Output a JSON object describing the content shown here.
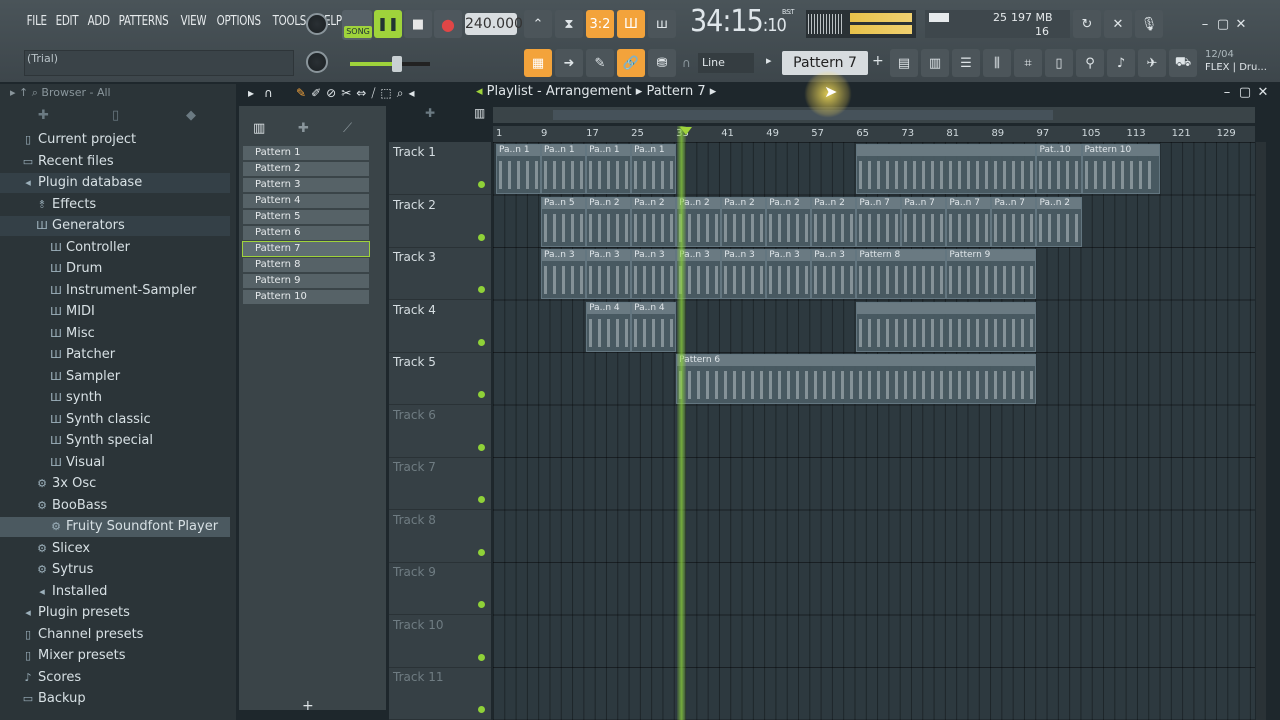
{
  "menu": [
    "FILE",
    "EDIT",
    "ADD",
    "PATTERNS",
    "VIEW",
    "OPTIONS",
    "TOOLS",
    "HELP"
  ],
  "hint_bar": "(Trial)",
  "song_mode": "SONG",
  "tempo": "240.000",
  "time_signature_indicator": "3:2",
  "timecode": {
    "main": "34:15",
    "sub": ":10",
    "label": "B:S:T"
  },
  "cpu": {
    "value": "25",
    "memory": "197 MB",
    "polyphony": "16"
  },
  "pattern_selector": "Pattern 7",
  "snap_mode": "Line",
  "news_panel": {
    "date": "12/04",
    "text": "FLEX | Dru..."
  },
  "browser": {
    "header": "Browser - All",
    "items": [
      {
        "label": "Current project",
        "icon": "doc-icon",
        "indent": 0
      },
      {
        "label": "Recent files",
        "icon": "folder-icon",
        "indent": 0
      },
      {
        "label": "Plugin database",
        "icon": "plug-icon",
        "indent": 0
      },
      {
        "label": "Effects",
        "icon": "effects-icon",
        "indent": 1
      },
      {
        "label": "Generators",
        "icon": "piano-icon",
        "indent": 1
      },
      {
        "label": "Controller",
        "icon": "piano-icon",
        "indent": 2
      },
      {
        "label": "Drum",
        "icon": "piano-icon",
        "indent": 2
      },
      {
        "label": "Instrument-Sampler",
        "icon": "piano-icon",
        "indent": 2
      },
      {
        "label": "MIDI",
        "icon": "piano-icon",
        "indent": 2
      },
      {
        "label": "Misc",
        "icon": "piano-icon",
        "indent": 2
      },
      {
        "label": "Patcher",
        "icon": "piano-icon",
        "indent": 2
      },
      {
        "label": "Sampler",
        "icon": "piano-icon",
        "indent": 2
      },
      {
        "label": "synth",
        "icon": "piano-icon",
        "indent": 2
      },
      {
        "label": "Synth classic",
        "icon": "piano-icon",
        "indent": 2
      },
      {
        "label": "Synth special",
        "icon": "piano-icon",
        "indent": 2
      },
      {
        "label": "Visual",
        "icon": "piano-icon",
        "indent": 2
      },
      {
        "label": "3x Osc",
        "icon": "gear-icon",
        "indent": 1
      },
      {
        "label": "BooBass",
        "icon": "gear-icon",
        "indent": 1
      },
      {
        "label": "Fruity Soundfont Player",
        "icon": "gear-icon",
        "indent": 2
      },
      {
        "label": "Slicex",
        "icon": "gear-icon",
        "indent": 1
      },
      {
        "label": "Sytrus",
        "icon": "gear-icon",
        "indent": 1
      },
      {
        "label": "Installed",
        "icon": "plug-icon",
        "indent": 1
      },
      {
        "label": "Plugin presets",
        "icon": "plug-icon",
        "indent": 0
      },
      {
        "label": "Channel presets",
        "icon": "preset-icon",
        "indent": 0
      },
      {
        "label": "Mixer presets",
        "icon": "preset-icon",
        "indent": 0
      },
      {
        "label": "Scores",
        "icon": "note-icon",
        "indent": 0
      },
      {
        "label": "Backup",
        "icon": "folder-icon",
        "indent": 0
      }
    ]
  },
  "patterns": [
    "Pattern 1",
    "Pattern 2",
    "Pattern 3",
    "Pattern 4",
    "Pattern 5",
    "Pattern 6",
    "Pattern 7",
    "Pattern 8",
    "Pattern 9",
    "Pattern 10"
  ],
  "selected_pattern": "Pattern 7",
  "playlist": {
    "title": "Playlist - Arrangement",
    "crumb": "Pattern 7",
    "ruler": [
      "1",
      "9",
      "17",
      "25",
      "33",
      "41",
      "49",
      "57",
      "65",
      "73",
      "81",
      "89",
      "97",
      "105",
      "113",
      "121",
      "129"
    ],
    "tracks": [
      "Track 1",
      "Track 2",
      "Track 3",
      "Track 4",
      "Track 5",
      "Track 6",
      "Track 7",
      "Track 8",
      "Track 9",
      "Track 10",
      "Track 11"
    ],
    "clips": [
      {
        "track": 0,
        "start": 1,
        "len": 8,
        "label": "Pa..n 1"
      },
      {
        "track": 0,
        "start": 9,
        "len": 8,
        "label": "Pa..n 1"
      },
      {
        "track": 0,
        "start": 17,
        "len": 8,
        "label": "Pa..n 1"
      },
      {
        "track": 0,
        "start": 25,
        "len": 8,
        "label": "Pa..n 1"
      },
      {
        "track": 0,
        "start": 65,
        "len": 32,
        "label": ""
      },
      {
        "track": 0,
        "start": 97,
        "len": 8,
        "label": "Pat..10"
      },
      {
        "track": 0,
        "start": 105,
        "len": 14,
        "label": "Pattern 10"
      },
      {
        "track": 1,
        "start": 9,
        "len": 8,
        "label": "Pa..n 5"
      },
      {
        "track": 1,
        "start": 17,
        "len": 8,
        "label": "Pa..n 2"
      },
      {
        "track": 1,
        "start": 25,
        "len": 8,
        "label": "Pa..n 2"
      },
      {
        "track": 1,
        "start": 33,
        "len": 8,
        "label": "Pa..n 2"
      },
      {
        "track": 1,
        "start": 41,
        "len": 8,
        "label": "Pa..n 2"
      },
      {
        "track": 1,
        "start": 49,
        "len": 8,
        "label": "Pa..n 2"
      },
      {
        "track": 1,
        "start": 57,
        "len": 8,
        "label": "Pa..n 2"
      },
      {
        "track": 1,
        "start": 65,
        "len": 8,
        "label": "Pa..n 7"
      },
      {
        "track": 1,
        "start": 73,
        "len": 8,
        "label": "Pa..n 7"
      },
      {
        "track": 1,
        "start": 81,
        "len": 8,
        "label": "Pa..n 7"
      },
      {
        "track": 1,
        "start": 89,
        "len": 8,
        "label": "Pa..n 7"
      },
      {
        "track": 1,
        "start": 97,
        "len": 8,
        "label": "Pa..n 2"
      },
      {
        "track": 2,
        "start": 9,
        "len": 8,
        "label": "Pa..n 3"
      },
      {
        "track": 2,
        "start": 17,
        "len": 8,
        "label": "Pa..n 3"
      },
      {
        "track": 2,
        "start": 25,
        "len": 8,
        "label": "Pa..n 3"
      },
      {
        "track": 2,
        "start": 33,
        "len": 8,
        "label": "Pa..n 3"
      },
      {
        "track": 2,
        "start": 41,
        "len": 8,
        "label": "Pa..n 3"
      },
      {
        "track": 2,
        "start": 49,
        "len": 8,
        "label": "Pa..n 3"
      },
      {
        "track": 2,
        "start": 57,
        "len": 8,
        "label": "Pa..n 3"
      },
      {
        "track": 2,
        "start": 65,
        "len": 16,
        "label": "Pattern 8"
      },
      {
        "track": 2,
        "start": 81,
        "len": 16,
        "label": "Pattern 9"
      },
      {
        "track": 3,
        "start": 17,
        "len": 8,
        "label": "Pa..n 4"
      },
      {
        "track": 3,
        "start": 25,
        "len": 8,
        "label": "Pa..n 4"
      },
      {
        "track": 3,
        "start": 65,
        "len": 32,
        "label": ""
      },
      {
        "track": 4,
        "start": 33,
        "len": 64,
        "label": "Pattern 6"
      }
    ]
  },
  "colors": {
    "accent": "#f3a33b",
    "play_green": "#9fd33b",
    "panel": "#2b3438"
  }
}
